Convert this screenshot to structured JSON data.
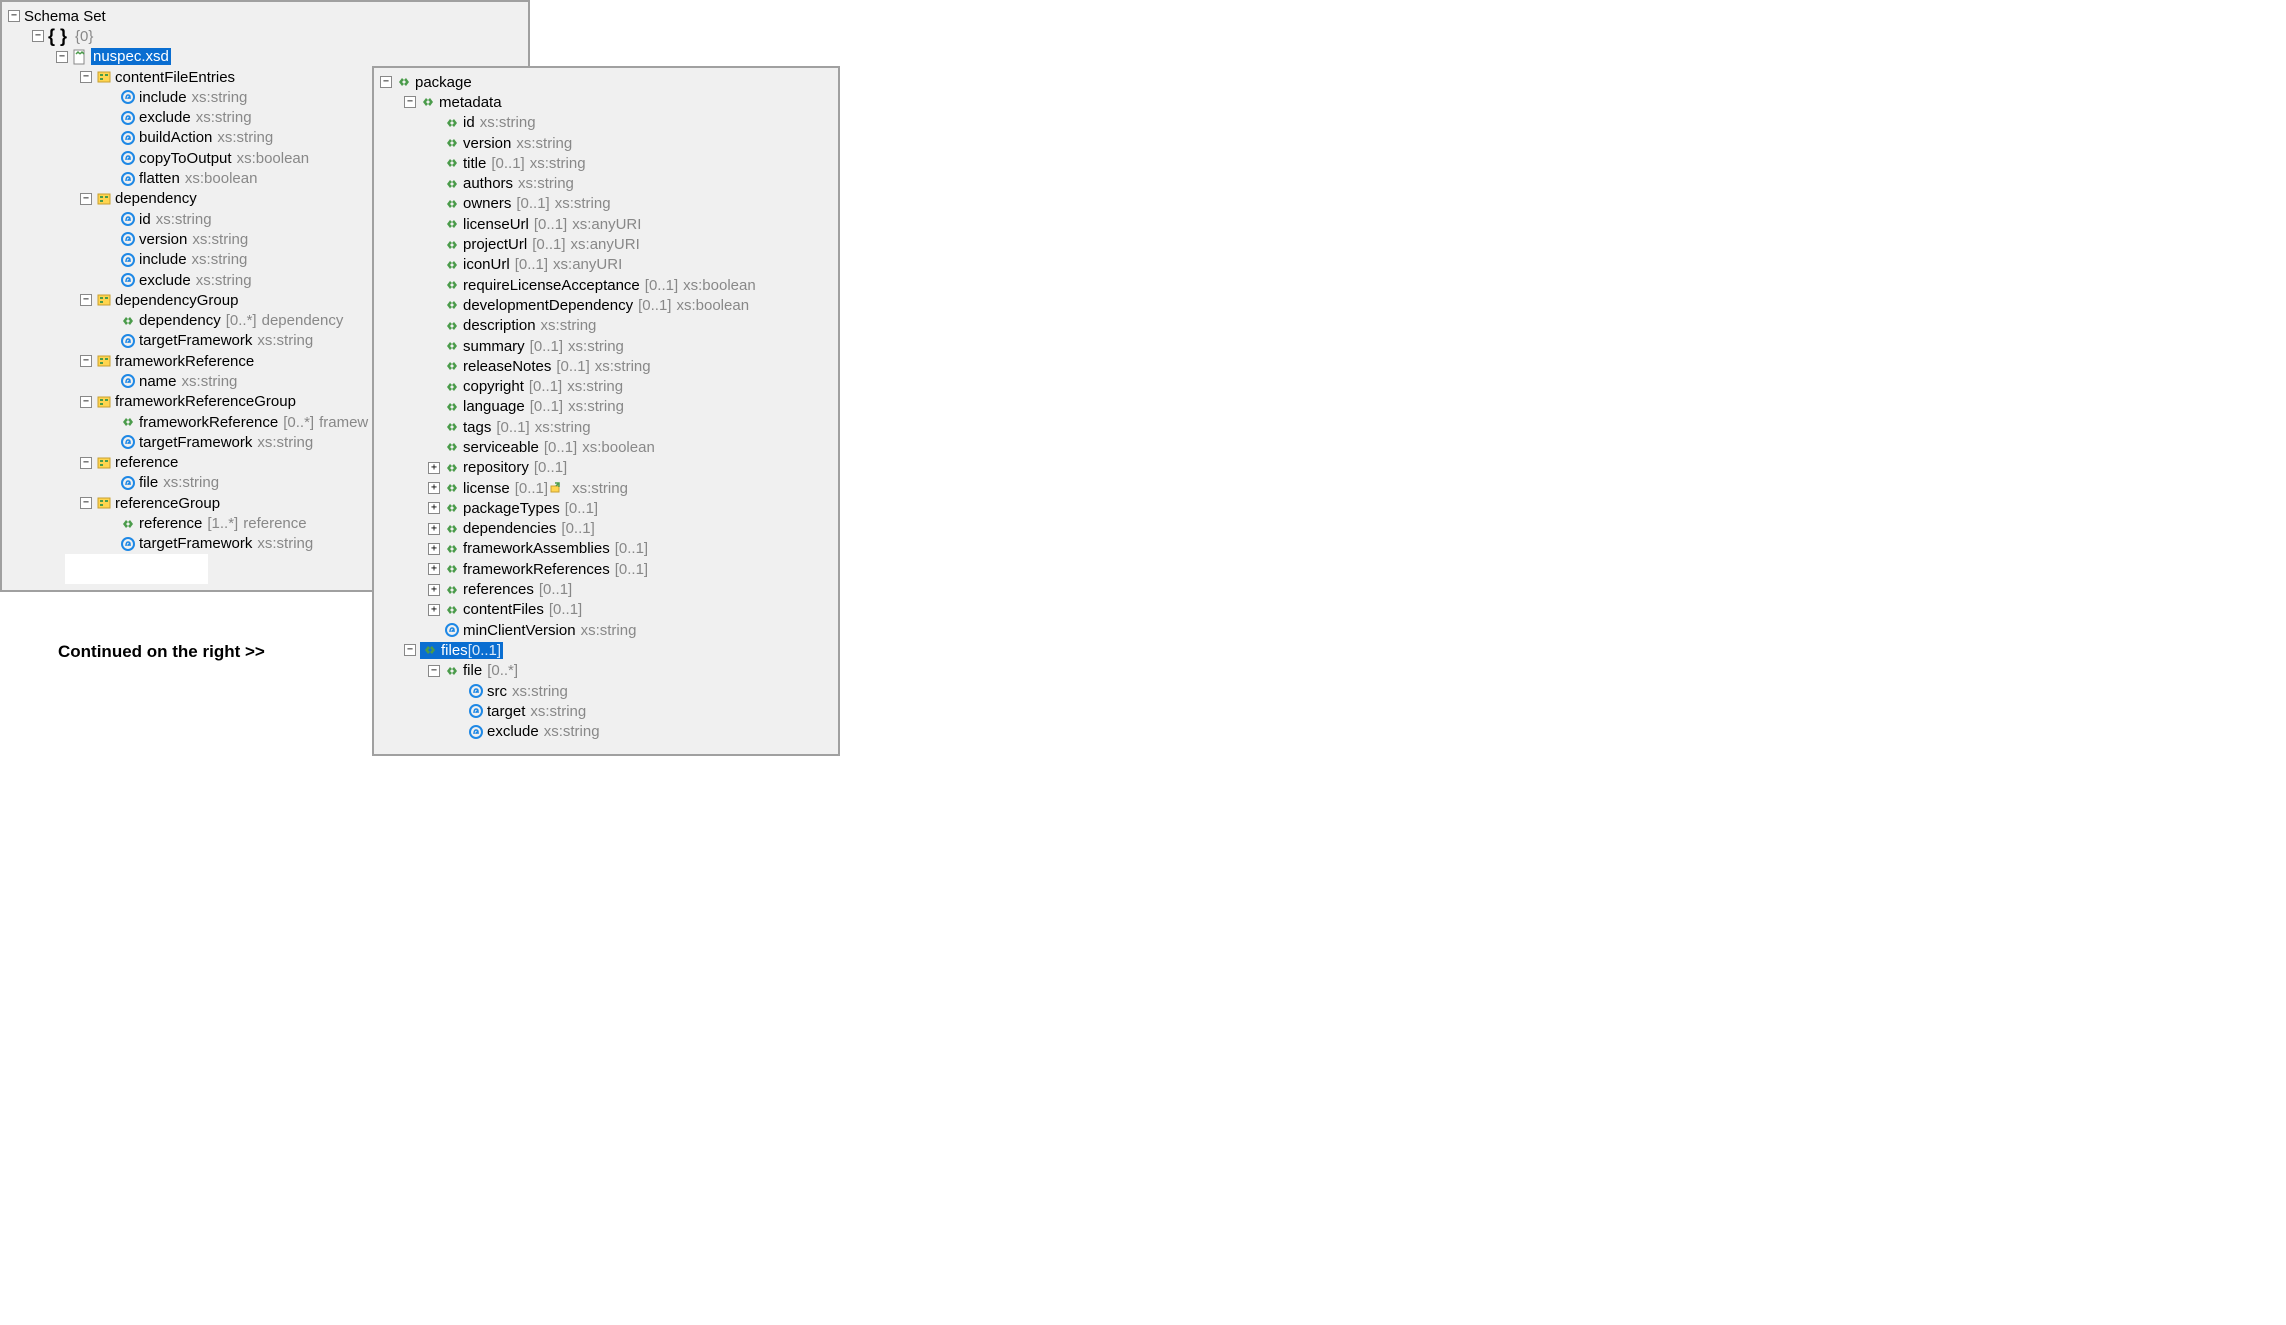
{
  "continued_text": "Continued on the right >>",
  "panel1_root": "Schema Set",
  "panel1_ns_count": "{0}",
  "panel1_file": "nuspec.xsd",
  "left_types": [
    {
      "name": "contentFileEntries",
      "attrs": [
        {
          "n": "include",
          "t": "xs:string"
        },
        {
          "n": "exclude",
          "t": "xs:string"
        },
        {
          "n": "buildAction",
          "t": "xs:string"
        },
        {
          "n": "copyToOutput",
          "t": "xs:boolean"
        },
        {
          "n": "flatten",
          "t": "xs:boolean"
        }
      ]
    },
    {
      "name": "dependency",
      "attrs": [
        {
          "n": "id",
          "t": "xs:string"
        },
        {
          "n": "version",
          "t": "xs:string"
        },
        {
          "n": "include",
          "t": "xs:string"
        },
        {
          "n": "exclude",
          "t": "xs:string"
        }
      ]
    },
    {
      "name": "dependencyGroup",
      "children": [
        {
          "kind": "el",
          "n": "dependency",
          "card": "[0..*]",
          "t": "dependency"
        },
        {
          "kind": "at",
          "n": "targetFramework",
          "t": "xs:string"
        }
      ]
    },
    {
      "name": "frameworkReference",
      "attrs": [
        {
          "n": "name",
          "t": "xs:string"
        }
      ]
    },
    {
      "name": "frameworkReferenceGroup",
      "children": [
        {
          "kind": "el",
          "n": "frameworkReference",
          "card": "[0..*]",
          "t": "framew"
        },
        {
          "kind": "at",
          "n": "targetFramework",
          "t": "xs:string"
        }
      ]
    },
    {
      "name": "reference",
      "attrs": [
        {
          "n": "file",
          "t": "xs:string"
        }
      ]
    },
    {
      "name": "referenceGroup",
      "children": [
        {
          "kind": "el",
          "n": "reference",
          "card": "[1..*]",
          "t": "reference"
        },
        {
          "kind": "at",
          "n": "targetFramework",
          "t": "xs:string"
        }
      ]
    }
  ],
  "right_root": "package",
  "right_metadata": "metadata",
  "metadata_children": [
    {
      "kind": "el",
      "n": "id",
      "t": "xs:string"
    },
    {
      "kind": "el",
      "n": "version",
      "t": "xs:string"
    },
    {
      "kind": "el",
      "n": "title",
      "card": "[0..1]",
      "t": "xs:string"
    },
    {
      "kind": "el",
      "n": "authors",
      "t": "xs:string"
    },
    {
      "kind": "el",
      "n": "owners",
      "card": "[0..1]",
      "t": "xs:string"
    },
    {
      "kind": "el",
      "n": "licenseUrl",
      "card": "[0..1]",
      "t": "xs:anyURI"
    },
    {
      "kind": "el",
      "n": "projectUrl",
      "card": "[0..1]",
      "t": "xs:anyURI"
    },
    {
      "kind": "el",
      "n": "iconUrl",
      "card": "[0..1]",
      "t": "xs:anyURI"
    },
    {
      "kind": "el",
      "n": "requireLicenseAcceptance",
      "card": "[0..1]",
      "t": "xs:boolean"
    },
    {
      "kind": "el",
      "n": "developmentDependency",
      "card": "[0..1]",
      "t": "xs:boolean"
    },
    {
      "kind": "el",
      "n": "description",
      "t": "xs:string"
    },
    {
      "kind": "el",
      "n": "summary",
      "card": "[0..1]",
      "t": "xs:string"
    },
    {
      "kind": "el",
      "n": "releaseNotes",
      "card": "[0..1]",
      "t": "xs:string"
    },
    {
      "kind": "el",
      "n": "copyright",
      "card": "[0..1]",
      "t": "xs:string"
    },
    {
      "kind": "el",
      "n": "language",
      "card": "[0..1]",
      "t": "xs:string"
    },
    {
      "kind": "el",
      "n": "tags",
      "card": "[0..1]",
      "t": "xs:string"
    },
    {
      "kind": "el",
      "n": "serviceable",
      "card": "[0..1]",
      "t": "xs:boolean"
    },
    {
      "kind": "el",
      "expand": "plus",
      "n": "repository",
      "card": "[0..1]"
    },
    {
      "kind": "el",
      "expand": "plus",
      "n": "license",
      "card": "[0..1]",
      "ext": "xs:string"
    },
    {
      "kind": "el",
      "expand": "plus",
      "n": "packageTypes",
      "card": "[0..1]"
    },
    {
      "kind": "el",
      "expand": "plus",
      "n": "dependencies",
      "card": "[0..1]"
    },
    {
      "kind": "el",
      "expand": "plus",
      "n": "frameworkAssemblies",
      "card": "[0..1]"
    },
    {
      "kind": "el",
      "expand": "plus",
      "n": "frameworkReferences",
      "card": "[0..1]"
    },
    {
      "kind": "el",
      "expand": "plus",
      "n": "references",
      "card": "[0..1]"
    },
    {
      "kind": "el",
      "expand": "plus",
      "n": "contentFiles",
      "card": "[0..1]"
    },
    {
      "kind": "at",
      "n": "minClientVersion",
      "t": "xs:string"
    }
  ],
  "right_files": {
    "n": "files",
    "card": "[0..1]",
    "sel": true
  },
  "right_file": {
    "n": "file",
    "card": "[0..*]"
  },
  "file_attrs": [
    {
      "n": "src",
      "t": "xs:string"
    },
    {
      "n": "target",
      "t": "xs:string"
    },
    {
      "n": "exclude",
      "t": "xs:string"
    }
  ]
}
